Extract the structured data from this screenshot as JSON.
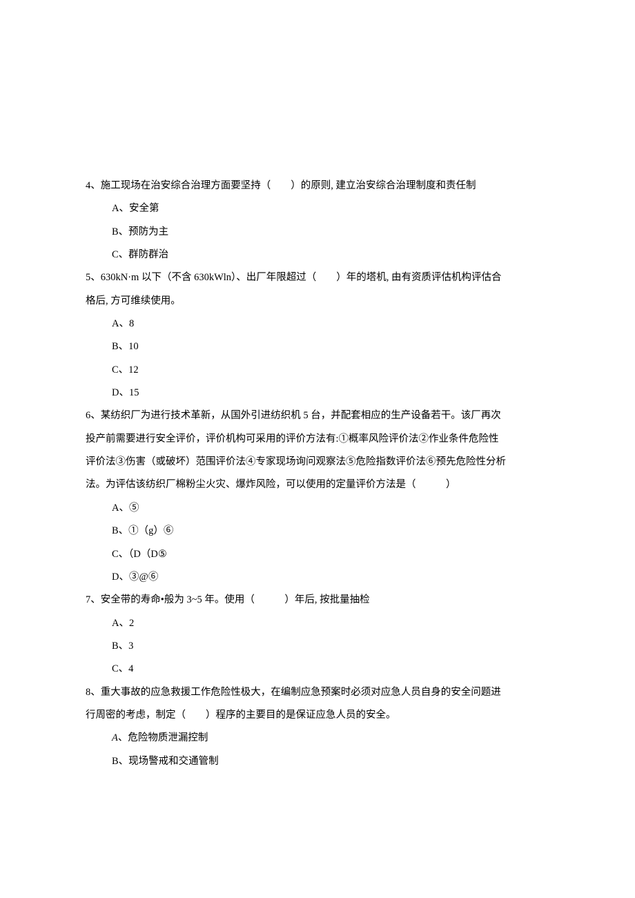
{
  "questions": [
    {
      "num": "4、",
      "text": "施工现场在治安综合治理方面要坚持（　　）的原则, 建立治安综合治理制度和责任制",
      "options": [
        "A、安全第",
        "B、预防为主",
        "C、群防群治"
      ]
    },
    {
      "num": "5、",
      "text_lines": [
        "630kN·m 以下（不含 630kWln）、出厂年限超过（　　）年的塔机, 由有资质评估机构评估合",
        "格后, 方可维续使用。"
      ],
      "options": [
        "A、8",
        "B、10",
        "C、12",
        "D、15"
      ]
    },
    {
      "num": "6、",
      "text_lines": [
        "某纺织厂为进行技术革新，从国外引进纺织机 5 台，并配套相应的生产设备若干。该厂再次",
        "投产前需要进行安全评价，评价机构可采用的评价方法有:①概率风险评价法②作业条件危险性",
        "评价法③伤害（或破坏）范围评价法④专家现场询问观察法⑤危险指数评价法⑥预先危险性分析",
        "法。为评估该纺织厂棉粉尘火灾、爆炸风险，可以使用的定量评价方法是（　　　）"
      ],
      "options": [
        "A、⑤",
        "B、①（g）⑥",
        "C、（D（D⑤",
        "D、③@⑥"
      ]
    },
    {
      "num": "7、",
      "text": "安全带的寿命•般为 3~5 年。使用（　　　）年后, 按批量抽检",
      "options": [
        "A、2",
        "B、3",
        "C、4"
      ]
    },
    {
      "num": "8、",
      "text_lines": [
        "重大事故的应急救援工作危险性极大，在编制应急预案时必须对应急人员自身的安全问题进",
        "行周密的考虑，制定（　　）程序的主要目的是保证应急人员的安全。"
      ],
      "options": [
        {
          "label": "A",
          "text": "、危险物质泄漏控制",
          "italic": true
        },
        "B、现场警戒和交通管制"
      ]
    }
  ]
}
